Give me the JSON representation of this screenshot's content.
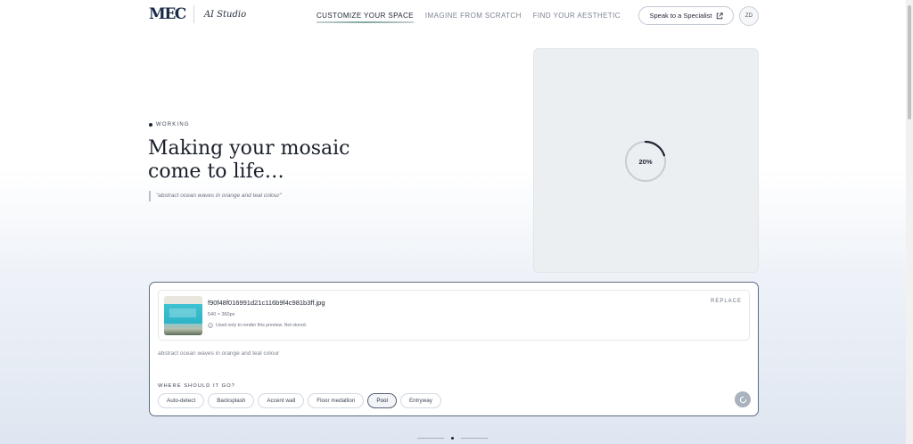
{
  "header": {
    "logo": "MEC",
    "studio_label": "AI Studio",
    "tabs": [
      {
        "label": "CUSTOMIZE YOUR SPACE",
        "active": true
      },
      {
        "label": "IMAGINE FROM SCRATCH",
        "active": false
      },
      {
        "label": "FIND YOUR AESTHETIC",
        "active": false
      }
    ],
    "specialist_button": "Speak to a Specialist",
    "avatar_initials": "ZD"
  },
  "hero": {
    "status": "WORKING",
    "heading": "Making your mosaic come to life…",
    "prompt_quote": "\"abstract ocean waves in orange and teal colour\""
  },
  "preview": {
    "progress_label": "20%",
    "progress_value": 0.2
  },
  "composer": {
    "file": {
      "name": "f90f48f016991d21c116b9f4c981b3ff.jpg",
      "dimensions": "540 × 360px",
      "note": "Used only to render this preview. Not stored."
    },
    "replace_label": "REPLACE",
    "prompt_value": "abstract ocean waves in orange and teal colour",
    "placement_label": "WHERE SHOULD IT GO?",
    "placements": [
      "Auto-detect",
      "Backsplash",
      "Accent wall",
      "Floor medallion",
      "Pool",
      "Entryway"
    ],
    "selected_placement": "Pool"
  },
  "colors": {
    "accent": "#1a2a48",
    "card_border": "#5b6b85",
    "progress_track": "#c9ccd1",
    "progress_arc": "#1f2533"
  }
}
